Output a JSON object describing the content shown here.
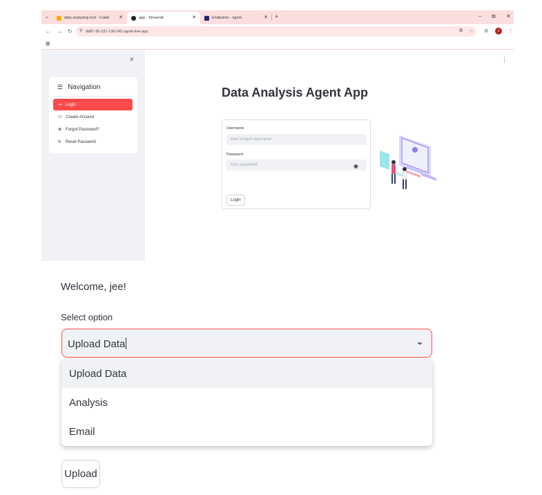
{
  "browser": {
    "tabs": [
      {
        "title": "data analyzing tool - Colab",
        "favicon": "colab-icon",
        "active": false
      },
      {
        "title": "app · Streamlit",
        "favicon": "streamlit-icon",
        "active": true
      },
      {
        "title": "Endpoints - ngrok",
        "favicon": "ngrok-icon",
        "active": false
      }
    ],
    "url": "0d87-35-221-139-243.ngrok-free.app",
    "profile_initial": "J"
  },
  "sidebar": {
    "title": "Navigation",
    "items": [
      {
        "label": "Login",
        "icon": "login-icon",
        "active": true
      },
      {
        "label": "Create Account",
        "icon": "add-person-icon",
        "active": false
      },
      {
        "label": "Forgot Password?",
        "icon": "cancel-circle-icon",
        "active": false
      },
      {
        "label": "Reset Password",
        "icon": "refresh-icon",
        "active": false
      }
    ]
  },
  "main": {
    "title": "Data Analysis Agent App",
    "form": {
      "username_label": "Username",
      "username_placeholder": "Your unique username",
      "password_label": "Password",
      "password_placeholder": "Your password",
      "login_button": "Login"
    }
  },
  "lower": {
    "welcome": "Welcome, jee!",
    "select_label": "Select option",
    "select_value": "Upload Data",
    "options": [
      "Upload Data",
      "Analysis",
      "Email"
    ],
    "upload_button": "Upload"
  },
  "colors": {
    "accent": "#ff4b4b",
    "tabbar_bg": "#fbdede",
    "sidebar_bg": "#f0f2f6",
    "text": "#31333f"
  }
}
